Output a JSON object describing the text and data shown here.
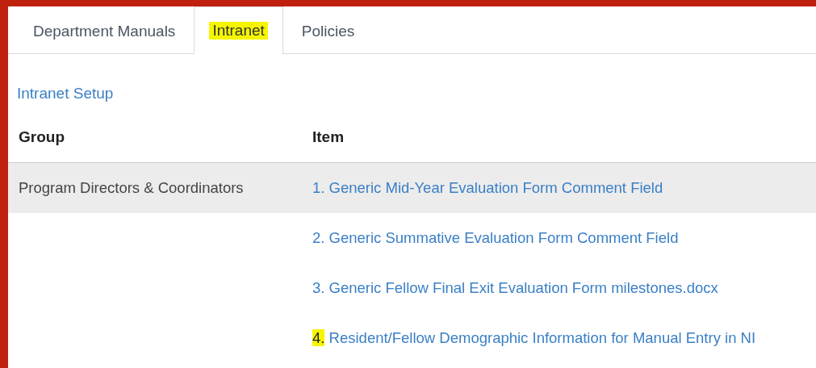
{
  "tabs": [
    {
      "label": "Department Manuals",
      "selected": false,
      "highlighted": false
    },
    {
      "label": "Intranet",
      "selected": true,
      "highlighted": true
    },
    {
      "label": "Policies",
      "selected": false,
      "highlighted": false
    }
  ],
  "setup_link": "Intranet Setup",
  "table": {
    "columns": [
      "Group",
      "Item"
    ],
    "rows": [
      {
        "group": "Program Directors & Coordinators",
        "number": "1.",
        "item": "Generic Mid-Year Evaluation Form Comment Field",
        "selected": true,
        "number_highlighted": false
      },
      {
        "number": "2.",
        "item": "Generic Summative Evaluation Form Comment Field",
        "selected": false,
        "number_highlighted": false
      },
      {
        "number": "3.",
        "item": "Generic Fellow Final Exit Evaluation Form milestones.docx",
        "selected": false,
        "number_highlighted": false
      },
      {
        "number": "4.",
        "item": "Resident/Fellow Demographic Information for Manual Entry in NI",
        "selected": false,
        "number_highlighted": true
      }
    ]
  }
}
